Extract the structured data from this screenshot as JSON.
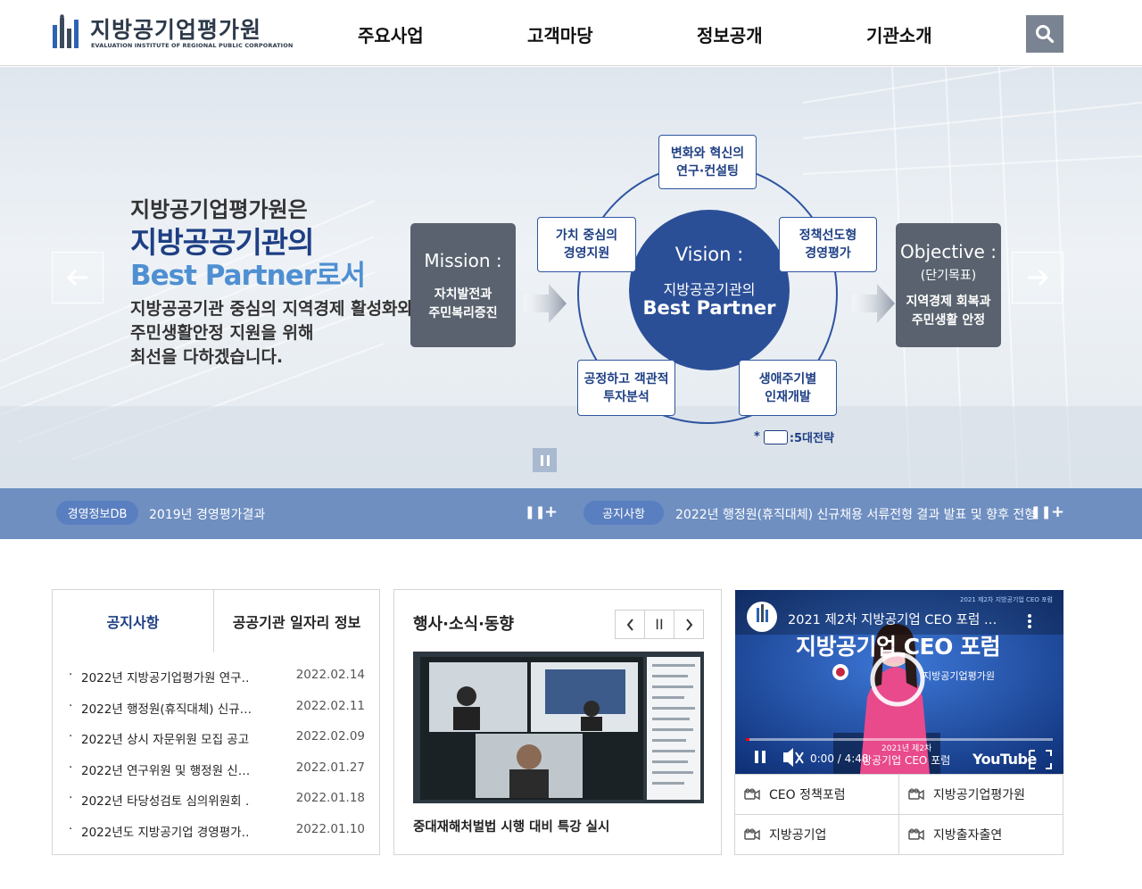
{
  "header": {
    "logo_title": "지방공기업평가원",
    "logo_sub": "EVALUATION INSTITUTE OF REGIONAL PUBLIC CORPORATION",
    "nav": [
      "주요사업",
      "고객마당",
      "정보공개",
      "기관소개"
    ],
    "search_icon": "search-icon"
  },
  "hero": {
    "line1": "지방공기업평가원은",
    "line2": "지방공공기관의",
    "line3": "Best Partner로서",
    "desc": [
      "지방공공기관 중심의 지역경제 활성화와",
      "주민생활안정 지원을 위해",
      "최선을 다하겠습니다."
    ],
    "mission_head": "Mission :",
    "mission_body": [
      "자치발전과",
      "주민복리증진"
    ],
    "vision_head": "Vision :",
    "vision_sub": "지방공공기관의",
    "vision_main": "Best Partner",
    "objective_head": "Objective :",
    "objective_sub": "(단기목표)",
    "objective_body": [
      "지역경제 회복과",
      "주민생활 안정"
    ],
    "strategies": [
      [
        "변화와 혁신의",
        "연구·컨설팅"
      ],
      [
        "정책선도형",
        "경영평가"
      ],
      [
        "생애주기별",
        "인재개발"
      ],
      [
        "공정하고 객관적",
        "투자분석"
      ],
      [
        "가치 중심의",
        "경영지원"
      ]
    ],
    "legend_prefix": "*",
    "legend_text": ":5대전략"
  },
  "noticebar": {
    "left_label": "경영정보DB",
    "left_text": "2019년 경영평가결과",
    "right_label": "공지사항",
    "right_text": "2022년 행정원(휴직대체) 신규채용 서류전형 결과 발표 및 향후 전형"
  },
  "notice_panel": {
    "tabs": [
      "공지사항",
      "공공기관 일자리 정보"
    ],
    "items": [
      {
        "title": "2022년 지방공기업평가원 연구…",
        "date": "2022.02.14"
      },
      {
        "title": "2022년 행정원(휴직대체) 신규…",
        "date": "2022.02.11"
      },
      {
        "title": "2022년 상시 자문위원 모집 공고",
        "date": "2022.02.09"
      },
      {
        "title": "2022년 연구위원 및 행정원 신…",
        "date": "2022.01.27"
      },
      {
        "title": "2022년 타당성검토 심의위원회 …",
        "date": "2022.01.18"
      },
      {
        "title": "2022년도 지방공기업 경영평가…",
        "date": "2022.01.10"
      }
    ]
  },
  "event_panel": {
    "title": "행사·소식·동향",
    "pause_label": "II",
    "caption": "중대재해처벌법 시행 대비 특강 실시"
  },
  "video": {
    "title": "2021 제2차 지방공기업 CEO 포럼 …",
    "banner": "2021 제2차 지방공기업 CEO 포럼",
    "big_text": "지방공기업 CEO 포럼",
    "org": "지방공기업평가원",
    "time": "0:00 / 4:48",
    "caption_bottom": "2021년 제2차",
    "caption_bottom2": "방공기업 CEO 포럼",
    "brand": "YouTube"
  },
  "links": [
    "CEO 정책포럼",
    "지방공기업평가원",
    "지방공기업",
    "지방출자출연"
  ],
  "colors": {
    "navy": "#1e3f84",
    "noticebar": "#6f8fc1",
    "pill_left": "#5a7fc0",
    "pill_right": "#5a7fc0",
    "dark_box": "#59626e"
  }
}
